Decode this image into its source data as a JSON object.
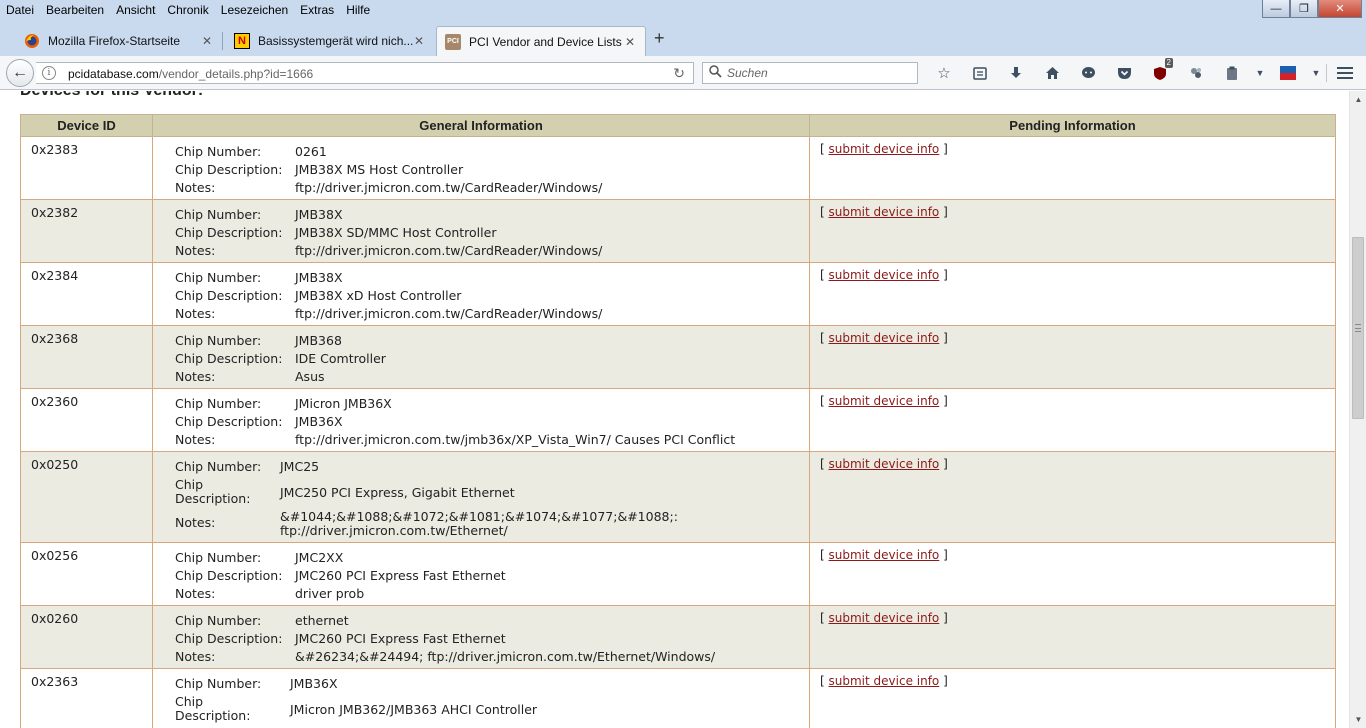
{
  "menubar": {
    "items": [
      "Datei",
      "Bearbeiten",
      "Ansicht",
      "Chronik",
      "Lesezeichen",
      "Extras",
      "Hilfe"
    ]
  },
  "window_controls": {
    "minimize": "—",
    "maximize": "❐",
    "close": "✕"
  },
  "tabs": [
    {
      "title": "Mozilla Firefox-Startseite",
      "icon": "firefox-icon",
      "active": false
    },
    {
      "title": "Basissystemgerät wird nich...",
      "icon": "n-logo-icon",
      "active": false
    },
    {
      "title": "PCI Vendor and Device Lists",
      "icon": "pcidb-icon",
      "active": true
    }
  ],
  "tab_icon_text": {
    "n_logo": "N",
    "pcidb": "PCI"
  },
  "newtab_label": "+",
  "navbar": {
    "url_host": "pcidatabase.com",
    "url_path": "/vendor_details.php?id=1666",
    "search_placeholder": "Suchen",
    "ublock_badge": "2"
  },
  "page": {
    "partial_heading": "Devices for this Vendor:",
    "table_headers": [
      "Device ID",
      "General Information",
      "Pending Information"
    ],
    "labels": {
      "chip_number": "Chip Number:",
      "chip_description": "Chip Description:",
      "chip_word": "Chip",
      "description_word": "Description:",
      "notes": "Notes:"
    },
    "pending_open": "[",
    "pending_close": "]",
    "submit_link": "submit device info",
    "devices": [
      {
        "id": "0x2383",
        "chip_number": "0261",
        "chip_description": "JMB38X MS Host Controller",
        "notes": "ftp://driver.jmicron.com.tw/CardReader/Windows/"
      },
      {
        "id": "0x2382",
        "chip_number": "JMB38X",
        "chip_description": "JMB38X SD/MMC Host Controller",
        "notes": "ftp://driver.jmicron.com.tw/CardReader/Windows/"
      },
      {
        "id": "0x2384",
        "chip_number": "JMB38X",
        "chip_description": "JMB38X xD Host Controller",
        "notes": "ftp://driver.jmicron.com.tw/CardReader/Windows/"
      },
      {
        "id": "0x2368",
        "chip_number": "JMB368",
        "chip_description": "IDE Comtroller",
        "notes": "Asus"
      },
      {
        "id": "0x2360",
        "chip_number": "JMicron JMB36X",
        "chip_description": "JMB36X",
        "notes": "ftp://driver.jmicron.com.tw/jmb36x/XP_Vista_Win7/ Causes PCI Conflict"
      },
      {
        "id": "0x0250",
        "chip_number": "JMC25",
        "chip_description": "JMC250 PCI Express, Gigabit Ethernet",
        "notes": "&#1044;&#1088;&#1072;&#1081;&#1074;&#1077;&#1088;: ftp://driver.jmicron.com.tw/Ethernet/"
      },
      {
        "id": "0x0256",
        "chip_number": "JMC2XX",
        "chip_description": "JMC260 PCI Express Fast Ethernet",
        "notes": "driver prob"
      },
      {
        "id": "0x0260",
        "chip_number": "ethernet",
        "chip_description": "JMC260 PCI Express Fast Ethernet",
        "notes": "&#26234;&#24494; ftp://driver.jmicron.com.tw/Ethernet/Windows/"
      },
      {
        "id": "0x2363",
        "chip_number": "JMB36X",
        "chip_description": "JMicron JMB362/JMB363 AHCI Controller",
        "notes": ""
      }
    ]
  },
  "colors": {
    "chrome": "#c9daef",
    "table_header": "#d3d0b0",
    "row_alt": "#ebebe1",
    "border": "#d9a77e",
    "link": "#8b1a1a"
  }
}
